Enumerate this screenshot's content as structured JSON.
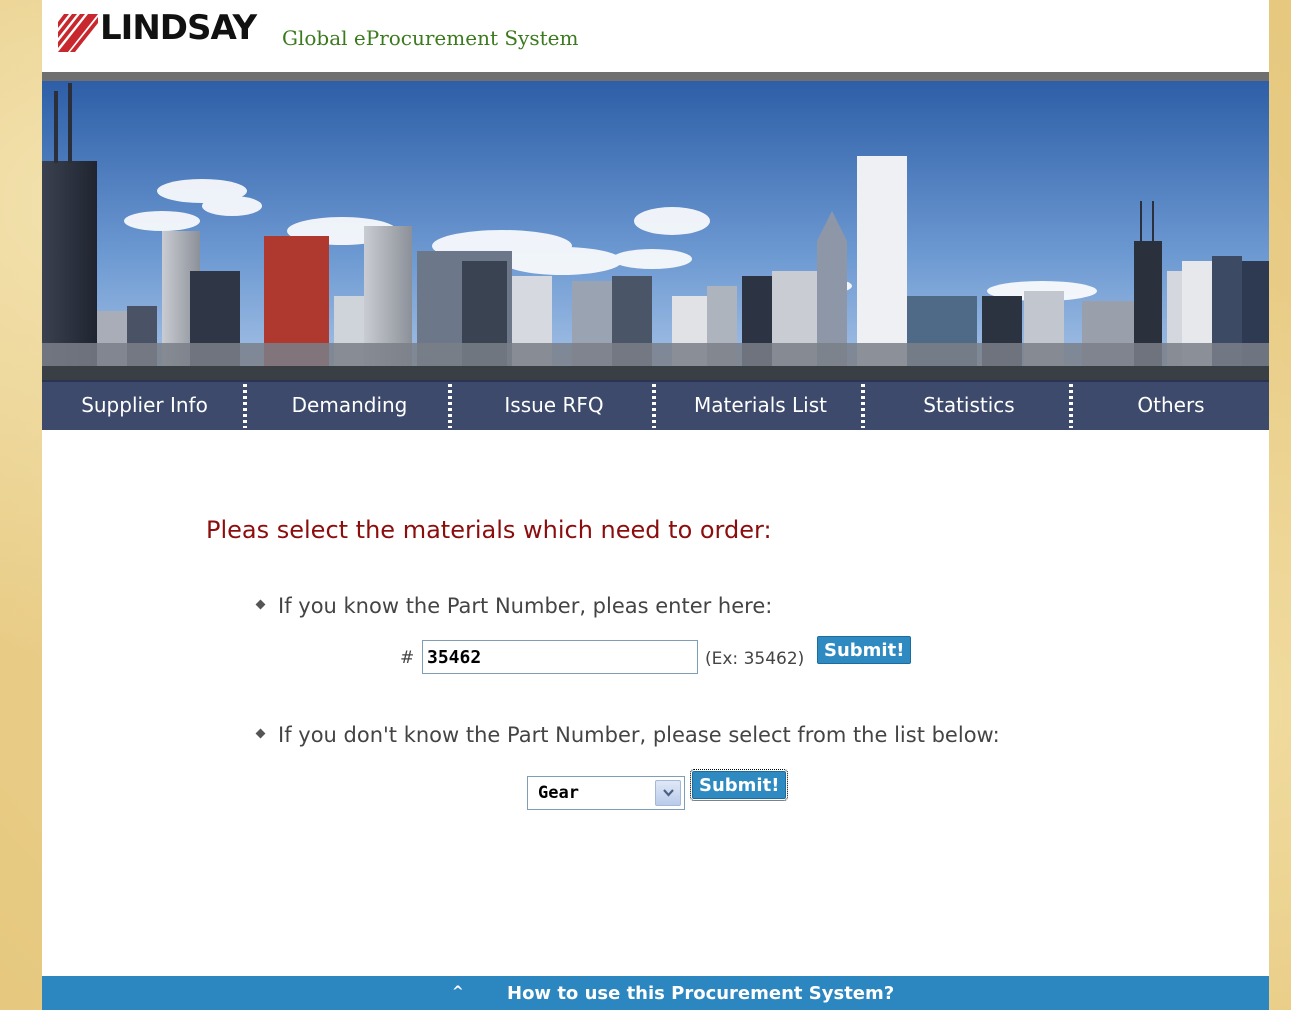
{
  "header": {
    "brand": "LINDSAY",
    "subtitle": "Global eProcurement System"
  },
  "nav": {
    "items": [
      {
        "label": "Supplier Info"
      },
      {
        "label": "Demanding"
      },
      {
        "label": "Issue RFQ"
      },
      {
        "label": "Materials List"
      },
      {
        "label": "Statistics"
      },
      {
        "label": "Others"
      }
    ]
  },
  "main": {
    "heading": "Pleas select the materials which need to order:",
    "part_number": {
      "instruction": "If you know the Part Number, pleas enter here:",
      "hash_label": "#",
      "value": "35462",
      "example": "(Ex: 35462)",
      "submit_label": "Submit!"
    },
    "list_select": {
      "instruction": "If you don't know the Part Number, please select from the list below:",
      "selected": "Gear",
      "submit_label": "Submit!"
    }
  },
  "footer": {
    "help_icon": "caret-up-icon",
    "help_text": "How to use this Procurement System?"
  },
  "colors": {
    "nav_bg": "#3d4a6b",
    "heading": "#8b0d0d",
    "accent_blue": "#2c86c0",
    "brand_green": "#3c7a1e",
    "brand_red": "#c8282d"
  }
}
